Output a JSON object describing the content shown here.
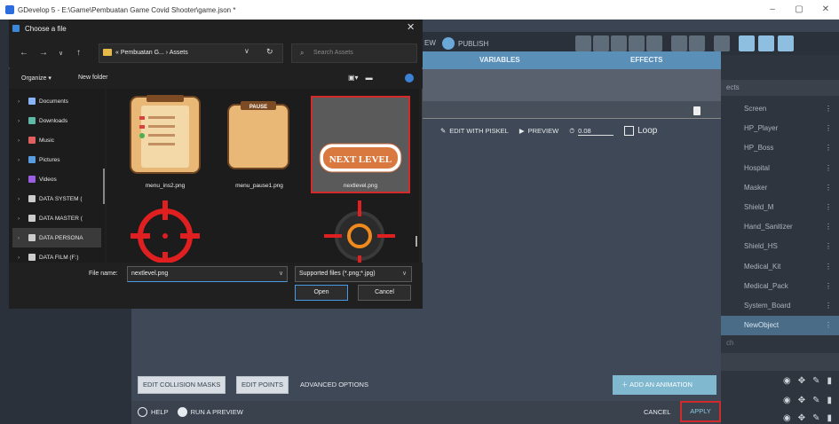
{
  "window": {
    "title": "GDevelop 5 - E:\\Game\\Pembuatan Game Covid Shooter\\game.json *",
    "controls": [
      "–",
      "▢",
      "✕"
    ]
  },
  "toolbar": {
    "publish_label": "PUBLISH",
    "preview_partial": "EW"
  },
  "object_editor": {
    "tabs": [
      "VARIABLES",
      "EFFECTS"
    ],
    "edit_with_piskel": "EDIT WITH PISKEL",
    "preview": "PREVIEW",
    "timing_value": "0.08",
    "loop_label": "Loop",
    "buttons": {
      "edit_collision_masks": "EDIT COLLISION MASKS",
      "edit_points": "EDIT POINTS",
      "advanced_options": "ADVANCED OPTIONS",
      "add_animation": "ADD AN ANIMATION",
      "help": "HELP",
      "run_preview": "RUN A PREVIEW",
      "cancel": "CANCEL",
      "apply": "APPLY"
    }
  },
  "objects_panel": {
    "header": "ects",
    "items": [
      "Screen",
      "HP_Player",
      "HP_Boss",
      "Hospital",
      "Masker",
      "Shield_M",
      "Hand_Sanitizer",
      "Shield_HS",
      "Medical_Kit",
      "Medical_Pack",
      "System_Board",
      "NewObject"
    ],
    "selected": "NewObject",
    "search_partial": "ch"
  },
  "file_dialog": {
    "title": "Choose a file",
    "path": "« Pembuatan G... › Assets",
    "search_placeholder": "Search Assets",
    "organize": "Organize ▾",
    "new_folder": "New folder",
    "sidebar": [
      {
        "label": "Documents",
        "color": "#8ab4f8"
      },
      {
        "label": "Downloads",
        "color": "#5fb8a8"
      },
      {
        "label": "Music",
        "color": "#e06060"
      },
      {
        "label": "Pictures",
        "color": "#5a9ce0"
      },
      {
        "label": "Videos",
        "color": "#9a5ee0"
      },
      {
        "label": "DATA SYSTEM (",
        "color": "#cccccc"
      },
      {
        "label": "DATA MASTER (",
        "color": "#cccccc"
      },
      {
        "label": "DATA PERSONA",
        "color": "#cccccc"
      },
      {
        "label": "DATA FILM (F:)",
        "color": "#cccccc"
      }
    ],
    "files": [
      {
        "name": "menu_ins2.png"
      },
      {
        "name": "menu_pause1.png"
      },
      {
        "name": "nextlevel.png"
      }
    ],
    "thumb_text": {
      "pause": "PAUSE",
      "next": "NEXT LEVEL"
    },
    "file_name_label": "File name:",
    "file_name_value": "nextlevel.png",
    "filter": "Supported files (*.png;*.jpg)",
    "open": "Open",
    "cancel": "Cancel"
  }
}
